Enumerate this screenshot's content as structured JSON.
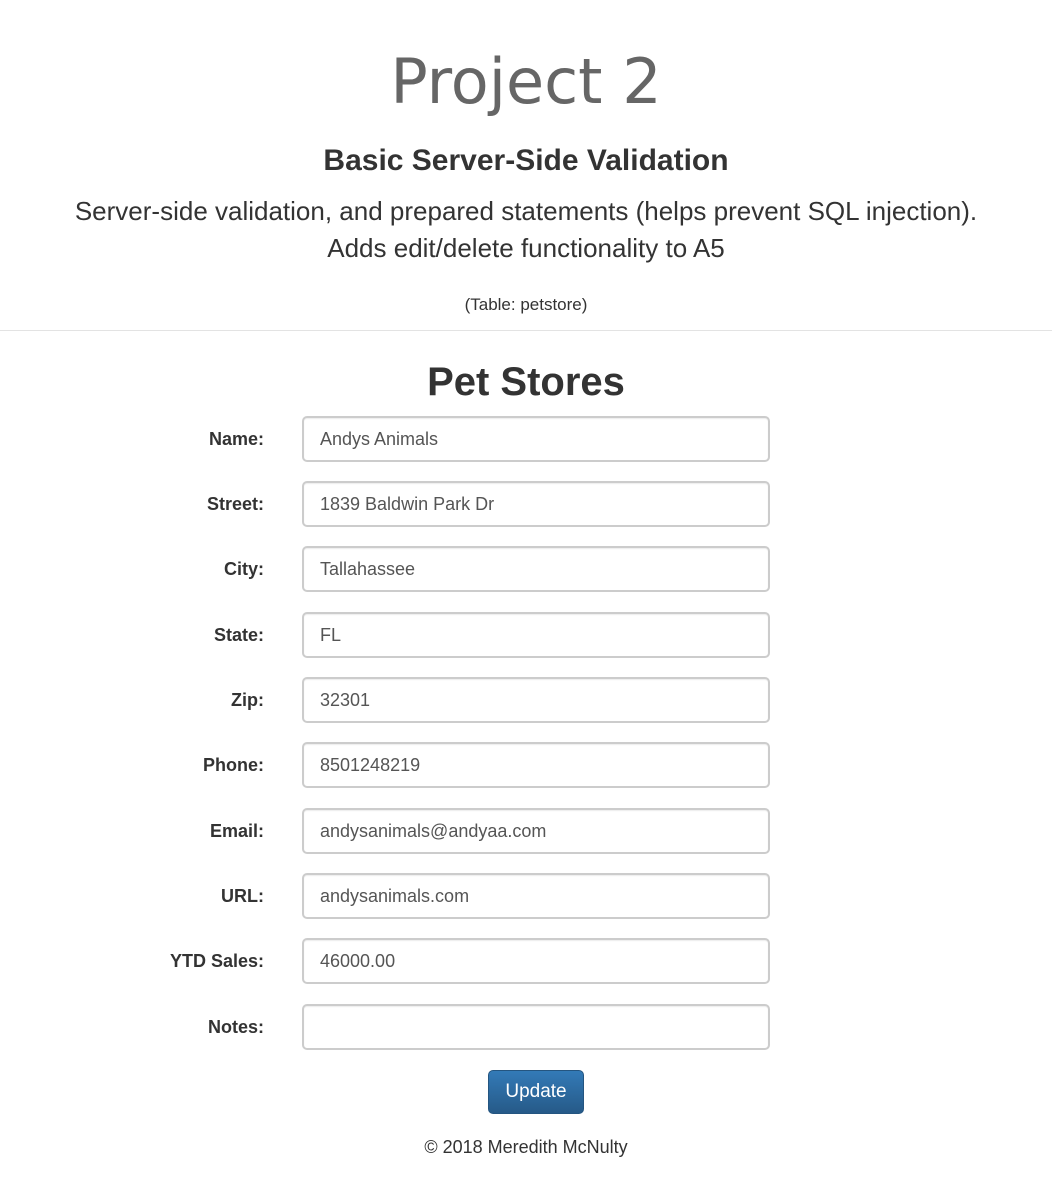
{
  "header": {
    "title": "Project 2",
    "subtitle": "Basic Server-Side Validation",
    "description_line1": "Server-side validation, and prepared statements (helps prevent SQL injection).",
    "description_line2": "Adds edit/delete functionality to A5",
    "table_note": "(Table: petstore)"
  },
  "main": {
    "heading": "Pet Stores",
    "fields": [
      {
        "label": "Name:",
        "value": "Andys Animals"
      },
      {
        "label": "Street:",
        "value": "1839 Baldwin Park Dr"
      },
      {
        "label": "City:",
        "value": "Tallahassee"
      },
      {
        "label": "State:",
        "value": "FL"
      },
      {
        "label": "Zip:",
        "value": "32301"
      },
      {
        "label": "Phone:",
        "value": "8501248219"
      },
      {
        "label": "Email:",
        "value": "andysanimals@andyaa.com"
      },
      {
        "label": "URL:",
        "value": "andysanimals.com"
      },
      {
        "label": "YTD Sales:",
        "value": "46000.00"
      },
      {
        "label": "Notes:",
        "value": ""
      }
    ],
    "update_label": "Update"
  },
  "footer": {
    "text": "© 2018 Meredith McNulty"
  },
  "colors": {
    "button": "#337ab7",
    "button_border": "#245580",
    "title": "#666666",
    "text": "#333333",
    "input_border": "#cccccc"
  }
}
